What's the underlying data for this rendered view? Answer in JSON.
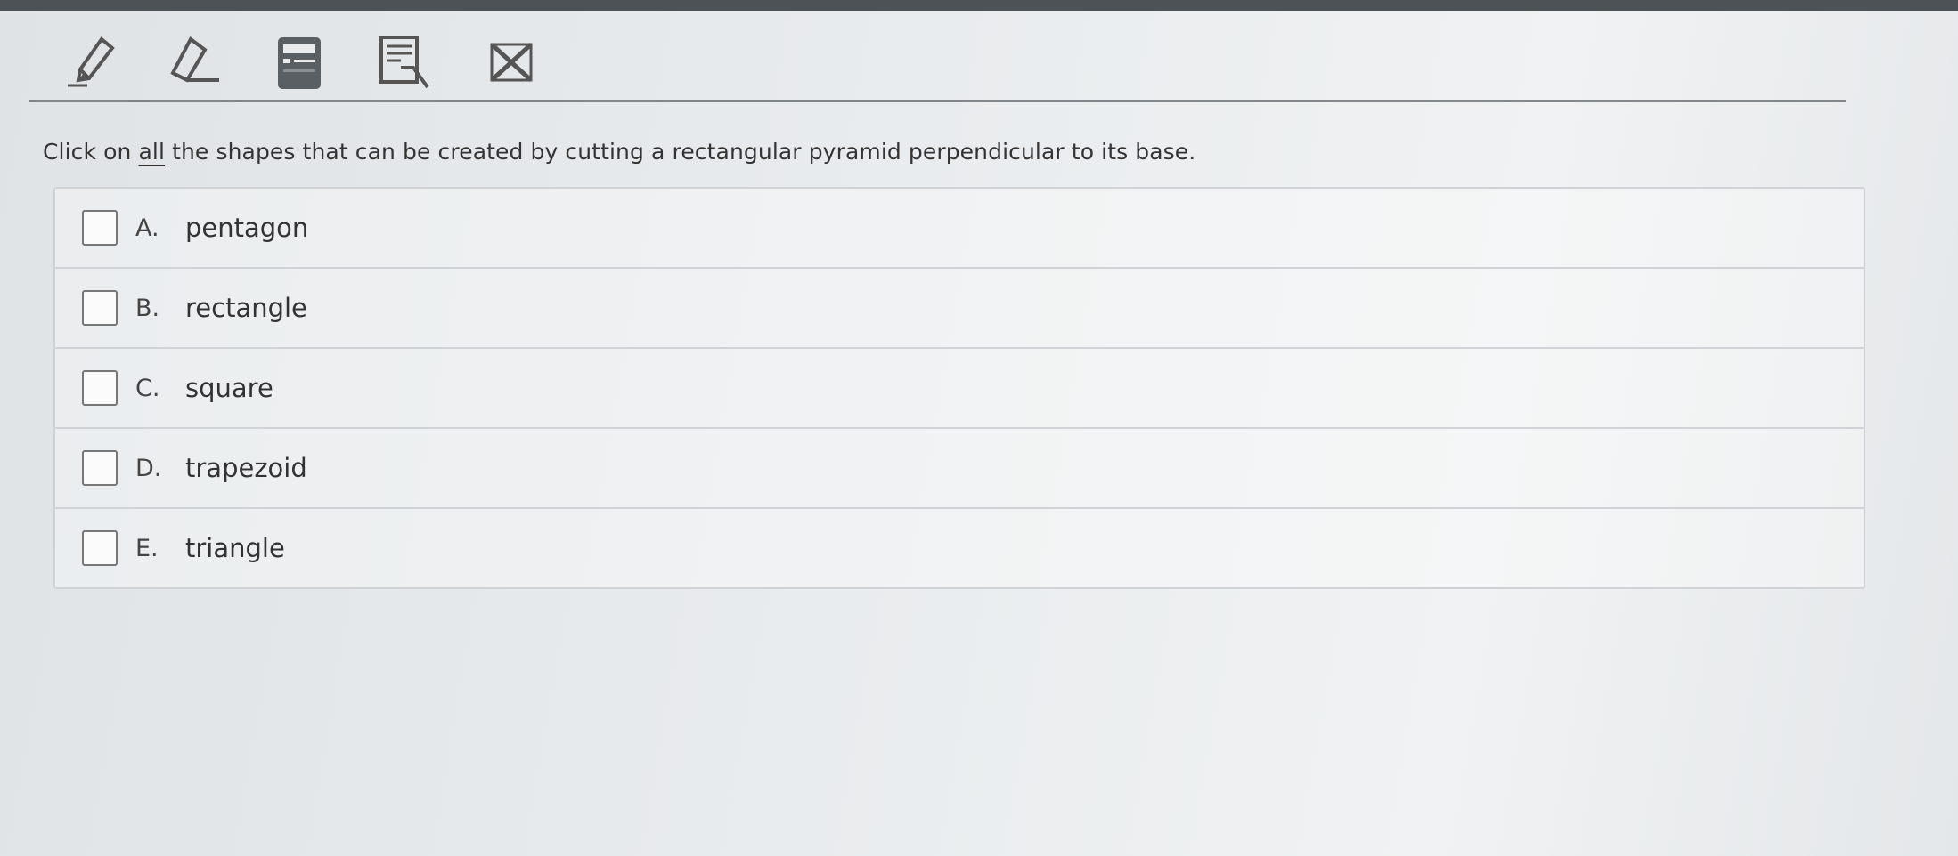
{
  "toolbar": {
    "tools": [
      {
        "name": "pencil-icon"
      },
      {
        "name": "eraser-icon"
      },
      {
        "name": "calculator-icon"
      },
      {
        "name": "reference-sheet-icon"
      },
      {
        "name": "close-icon"
      }
    ]
  },
  "question": {
    "prefix": "Click on ",
    "emphasis": "all",
    "suffix": " the shapes that can be created by cutting a rectangular pyramid perpendicular to its base."
  },
  "choices": [
    {
      "letter": "A.",
      "text": "pentagon",
      "checked": false
    },
    {
      "letter": "B.",
      "text": "rectangle",
      "checked": false
    },
    {
      "letter": "C.",
      "text": "square",
      "checked": false
    },
    {
      "letter": "D.",
      "text": "trapezoid",
      "checked": false
    },
    {
      "letter": "E.",
      "text": "triangle",
      "checked": false
    }
  ],
  "colors": {
    "text": "#333333",
    "rule": "#5d6368",
    "border": "#cfd3d6"
  }
}
